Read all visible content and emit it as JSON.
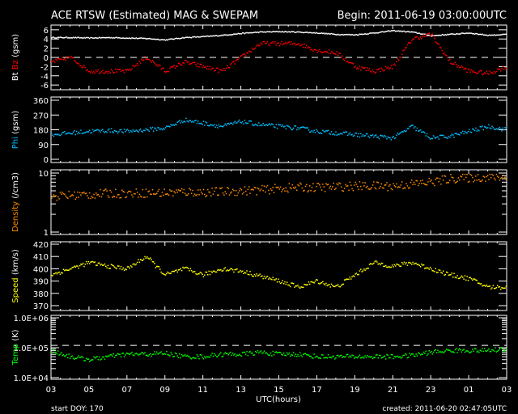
{
  "header": {
    "title": "ACE RTSW (Estimated) MAG & SWEPAM",
    "begin": "Begin: 2011-06-19 03:00:00UTC"
  },
  "footer": {
    "start_doy": "start DOY: 170",
    "created": "created: 2011-06-20 02:47:05UTC",
    "xlabel": "UTC(hours)"
  },
  "colors": {
    "bt": "#ffffff",
    "bz": "#ff0000",
    "phi": "#00bfff",
    "density": "#ff8c00",
    "speed": "#ffff00",
    "temp": "#00ff00"
  },
  "chart_data": {
    "type": "scatter",
    "x_ticks": [
      "03",
      "05",
      "07",
      "09",
      "11",
      "13",
      "15",
      "17",
      "19",
      "21",
      "23",
      "01",
      "03"
    ],
    "x_range_hours": [
      0,
      24
    ],
    "x_hourly": [
      0,
      1,
      2,
      3,
      4,
      5,
      6,
      7,
      8,
      9,
      10,
      11,
      12,
      13,
      14,
      15,
      16,
      17,
      18,
      19,
      20,
      21,
      22,
      23,
      24
    ],
    "panels": [
      {
        "key": "mag",
        "ylabel_parts": [
          "Bt",
          "Bz",
          "(gsm)"
        ],
        "scale": "linear",
        "ylim": [
          -6.5,
          6.5
        ],
        "ticks": [
          "6",
          "4",
          "2",
          "0",
          "-2",
          "-4",
          "-6"
        ],
        "tick_values": [
          6,
          4,
          2,
          0,
          -2,
          -4,
          -6
        ],
        "dashed_at": 0,
        "series": [
          {
            "name": "Bt",
            "color": "#ffffff",
            "values": [
              4.3,
              4.3,
              4.2,
              4.3,
              4.2,
              4.1,
              3.8,
              4.3,
              4.5,
              4.8,
              5.2,
              5.5,
              5.6,
              5.5,
              5.3,
              5.0,
              4.9,
              5.3,
              5.8,
              5.5,
              4.7,
              5.0,
              5.3,
              4.8,
              5.0
            ]
          },
          {
            "name": "Bz",
            "color": "#ff0000",
            "values": [
              -1,
              0,
              -3,
              -3,
              -3,
              0,
              -3,
              -1,
              -2,
              -3,
              0,
              3,
              3,
              3,
              1.5,
              1,
              -2,
              -3,
              -2,
              4,
              5,
              -1,
              -3,
              -3.5,
              -2
            ]
          }
        ]
      },
      {
        "key": "phi",
        "ylabel_parts": [
          "Phi",
          "(gsm)"
        ],
        "scale": "linear",
        "ylim": [
          0,
          360
        ],
        "ticks": [
          "360",
          "270",
          "180",
          "90",
          "0"
        ],
        "tick_values": [
          360,
          270,
          180,
          90,
          0
        ],
        "series": [
          {
            "name": "Phi",
            "color": "#00bfff",
            "values": [
              150,
              160,
              170,
              175,
              170,
              180,
              190,
              240,
              220,
              200,
              230,
              210,
              200,
              190,
              170,
              160,
              150,
              140,
              130,
              200,
              130,
              140,
              170,
              200,
              180
            ]
          }
        ]
      },
      {
        "key": "density",
        "ylabel_parts": [
          "Density",
          "(/cm3)"
        ],
        "scale": "log",
        "ylim": [
          1,
          10
        ],
        "ticks": [
          "10",
          "1"
        ],
        "tick_values": [
          10,
          1
        ],
        "series": [
          {
            "name": "Density",
            "color": "#ff8c00",
            "values": [
              4,
              4.2,
              4.3,
              4.5,
              4.5,
              4.6,
              4.6,
              4.8,
              4.7,
              4.8,
              5,
              5.1,
              5.5,
              5.7,
              5.7,
              5.8,
              6,
              6,
              6,
              6.5,
              7,
              8,
              8.3,
              8.5,
              8.5
            ]
          }
        ]
      },
      {
        "key": "speed",
        "ylabel_parts": [
          "Speed",
          "(km/s)"
        ],
        "scale": "linear",
        "ylim": [
          370,
          420
        ],
        "ticks": [
          "420",
          "410",
          "400",
          "390",
          "380",
          "370"
        ],
        "tick_values": [
          420,
          410,
          400,
          390,
          380,
          370
        ],
        "series": [
          {
            "name": "Speed",
            "color": "#ffff00",
            "values": [
              395,
              400,
              405,
              402,
              400,
              410,
              395,
              400,
              395,
              400,
              398,
              394,
              390,
              385,
              390,
              385,
              395,
              405,
              402,
              405,
              400,
              395,
              392,
              385,
              385
            ]
          }
        ]
      },
      {
        "key": "temp",
        "ylabel_parts": [
          "Temp",
          "(K)"
        ],
        "scale": "log",
        "ylim": [
          10000,
          1000000
        ],
        "ticks": [
          "1.0E+06",
          "1.0E+05",
          "1.0E+04"
        ],
        "tick_values": [
          1000000,
          100000,
          10000
        ],
        "dashed_at": 120000,
        "series": [
          {
            "name": "Temp",
            "color": "#00ff00",
            "values": [
              80000,
              50000,
              40000,
              50000,
              60000,
              60000,
              65000,
              50000,
              50000,
              60000,
              60000,
              70000,
              60000,
              60000,
              50000,
              50000,
              50000,
              50000,
              50000,
              55000,
              70000,
              80000,
              80000,
              80000,
              90000
            ]
          }
        ]
      }
    ]
  }
}
